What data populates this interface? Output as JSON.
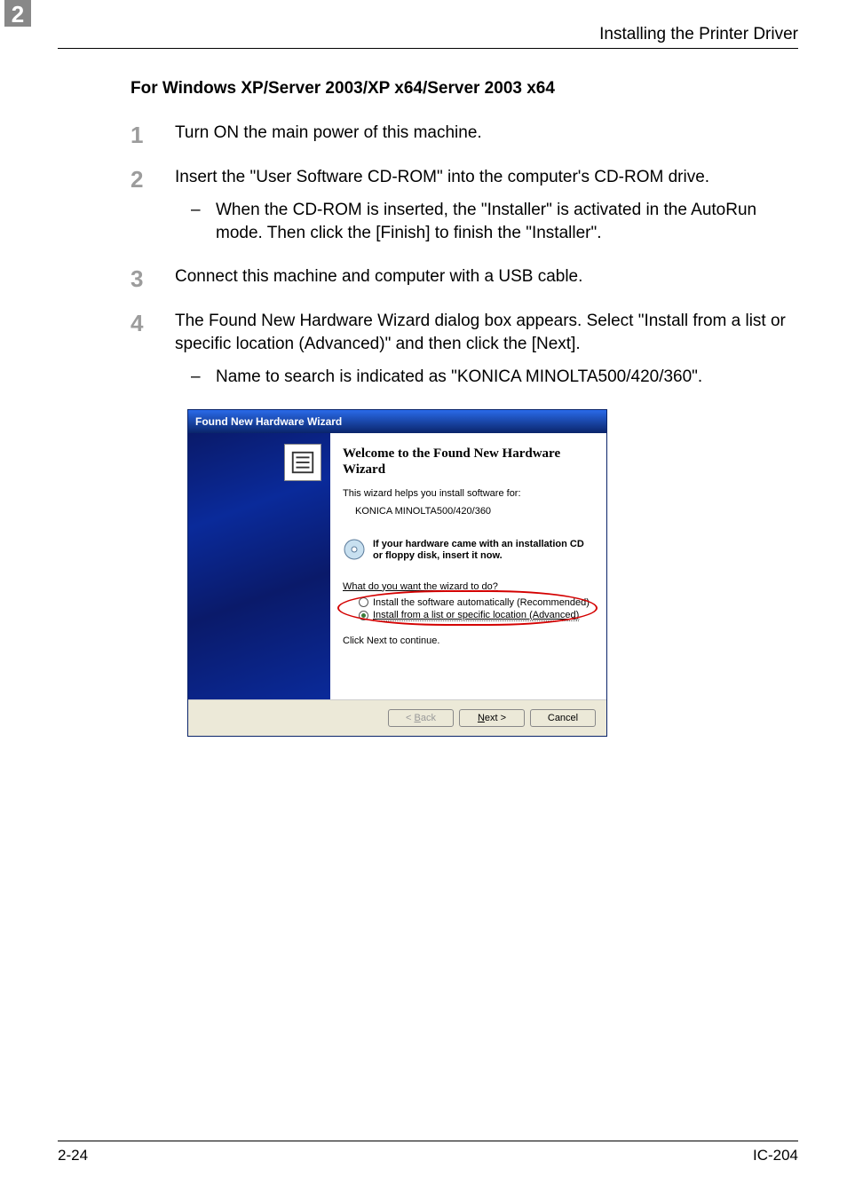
{
  "chapter_number": "2",
  "header_title": "Installing the Printer Driver",
  "section_title": "For Windows XP/Server 2003/XP x64/Server 2003 x64",
  "steps": [
    {
      "num": "1",
      "text": "Turn ON the main power of this machine."
    },
    {
      "num": "2",
      "text": "Insert the \"User Software CD-ROM\" into the computer's CD-ROM drive.",
      "sub": "When the CD-ROM is inserted, the \"Installer\" is activated in the AutoRun mode. Then click the [Finish] to finish the \"Installer\"."
    },
    {
      "num": "3",
      "text": "Connect this machine and computer with a USB cable."
    },
    {
      "num": "4",
      "text": "The Found New Hardware Wizard dialog box appears. Select \"Install from a list or specific location (Advanced)\" and then click the [Next].",
      "sub": "Name to search is indicated as \"KONICA MINOLTA500/420/360\"."
    }
  ],
  "dialog": {
    "title": "Found New Hardware Wizard",
    "heading": "Welcome to the Found New Hardware Wizard",
    "helps_text": "This wizard helps you install software for:",
    "device_name": "KONICA MINOLTA500/420/360",
    "cd_hint": "If your hardware came with an installation CD or floppy disk, insert it now.",
    "question": "What do you want the wizard to do?",
    "option_auto": "Install the software automatically (Recommended)",
    "option_list": "Install from a list or specific location (Advanced)",
    "continue_text": "Click Next to continue.",
    "buttons": {
      "back": "< Back",
      "next": "Next >",
      "cancel": "Cancel"
    }
  },
  "footer": {
    "left": "2-24",
    "right": "IC-204"
  }
}
